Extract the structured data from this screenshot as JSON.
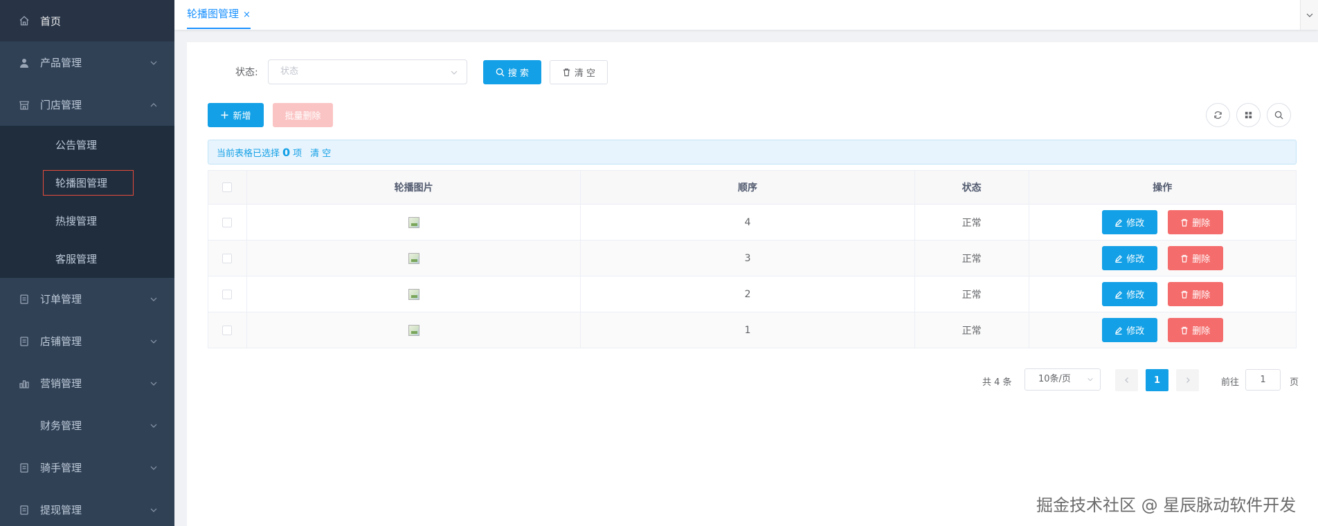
{
  "sidebar": {
    "home": "首页",
    "items": [
      {
        "label": "产品管理",
        "icon": "user-icon"
      },
      {
        "label": "门店管理",
        "icon": "store-icon"
      },
      {
        "label": "订单管理",
        "icon": "document-icon"
      },
      {
        "label": "店铺管理",
        "icon": "document-icon"
      },
      {
        "label": "营销管理",
        "icon": "bar-chart-icon"
      },
      {
        "label": "财务管理",
        "icon": ""
      },
      {
        "label": "骑手管理",
        "icon": "document-icon"
      },
      {
        "label": "提现管理",
        "icon": "document-icon"
      }
    ],
    "store_submenu": [
      "公告管理",
      "轮播图管理",
      "热搜管理",
      "客服管理"
    ]
  },
  "tabs": [
    {
      "label": "轮播图管理",
      "close": "×"
    }
  ],
  "filter": {
    "status_label": "状态:",
    "status_placeholder": "状态",
    "search_label": "搜 索",
    "clear_label": "清 空"
  },
  "toolbar": {
    "add_label": "新增",
    "batch_delete_label": "批量删除"
  },
  "selection_alert": {
    "prefix": "当前表格已选择",
    "count": "0",
    "suffix": "项",
    "clear": "清 空"
  },
  "table": {
    "columns": [
      "轮播图片",
      "顺序",
      "状态",
      "操作"
    ],
    "rows": [
      {
        "order": "4",
        "status": "正常"
      },
      {
        "order": "3",
        "status": "正常"
      },
      {
        "order": "2",
        "status": "正常"
      },
      {
        "order": "1",
        "status": "正常"
      }
    ],
    "edit_label": "修改",
    "delete_label": "删除"
  },
  "pagination": {
    "total": "共 4 条",
    "page_size": "10条/页",
    "current_page": "1",
    "goto_label": "前往",
    "goto_value": "1",
    "goto_suffix": "页"
  },
  "watermark": "掘金技术社区 @ 星辰脉动软件开发",
  "colors": {
    "sidebar_bg": "#304156",
    "submenu_bg": "#1f2d3d",
    "primary": "#13a0e6",
    "danger": "#f56c6c",
    "highlight_border": "#e74c3c"
  }
}
